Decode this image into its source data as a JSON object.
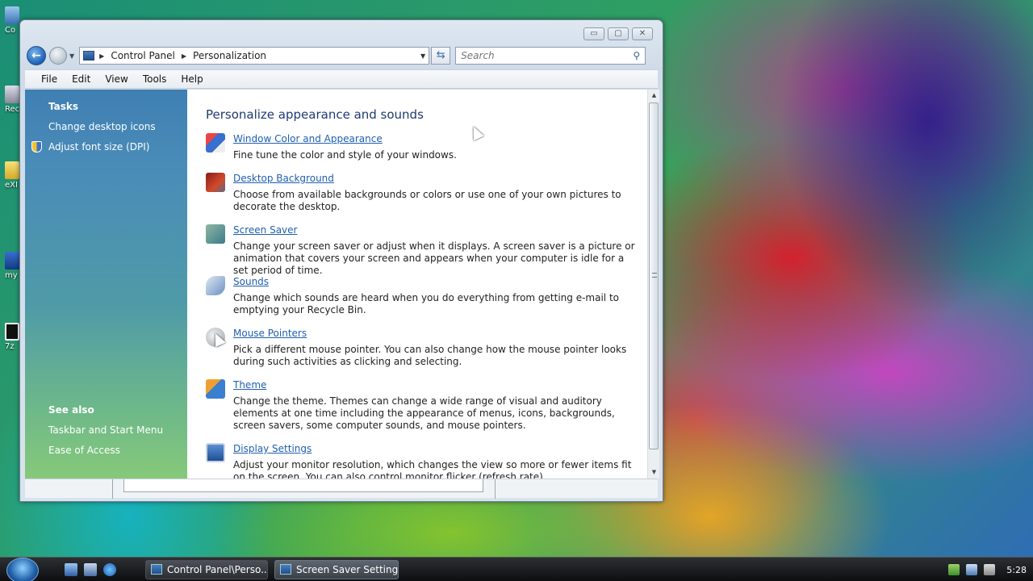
{
  "desktop": {
    "icons": [
      {
        "label": "Co"
      },
      {
        "label": "Rec"
      },
      {
        "label": "eXI"
      },
      {
        "label": "my"
      },
      {
        "label": "7z"
      }
    ]
  },
  "window": {
    "title_buttons": {
      "minimize": "▭",
      "maximize": "▢",
      "close": "✕"
    },
    "address": {
      "segments": [
        "Control Panel",
        "Personalization"
      ]
    },
    "search": {
      "placeholder": "Search"
    },
    "menu": [
      "File",
      "Edit",
      "View",
      "Tools",
      "Help"
    ],
    "sidebar": {
      "tasks_heading": "Tasks",
      "tasks": [
        "Change desktop icons",
        "Adjust font size (DPI)"
      ],
      "see_also_heading": "See also",
      "see_also": [
        "Taskbar and Start Menu",
        "Ease of Access"
      ]
    },
    "content": {
      "heading": "Personalize appearance and sounds",
      "items": [
        {
          "title": "Window Color and Appearance",
          "description": "Fine tune the color and style of your windows.",
          "icon": "window-color-icon"
        },
        {
          "title": "Desktop Background",
          "description": "Choose from available backgrounds or colors or use one of your own pictures to decorate the desktop.",
          "icon": "desktop-background-icon"
        },
        {
          "title": "Screen Saver",
          "description": "Change your screen saver or adjust when it displays. A screen saver is a picture or animation that covers your screen and appears when your computer is idle for a set period of time.",
          "icon": "screen-saver-icon"
        },
        {
          "title": "Sounds",
          "description": "Change which sounds are heard when you do everything from getting e-mail to emptying your Recycle Bin.",
          "icon": "sounds-icon"
        },
        {
          "title": "Mouse Pointers",
          "description": "Pick a different mouse pointer. You can also change how the mouse pointer looks during such activities as clicking and selecting.",
          "icon": "mouse-pointers-icon"
        },
        {
          "title": "Theme",
          "description": "Change the theme. Themes can change a wide range of visual and auditory elements at one time including the appearance of menus, icons, backgrounds, screen savers, some computer sounds, and mouse pointers.",
          "icon": "theme-icon"
        },
        {
          "title": "Display Settings",
          "description": "Adjust your monitor resolution, which changes the view so more or fewer items fit on the screen. You can also control monitor flicker (refresh rate).",
          "icon": "display-settings-icon"
        }
      ]
    }
  },
  "taskbar": {
    "buttons": [
      {
        "label": "Control Panel\\Perso..."
      },
      {
        "label": "Screen Saver Settings"
      }
    ],
    "clock": "5:28"
  }
}
